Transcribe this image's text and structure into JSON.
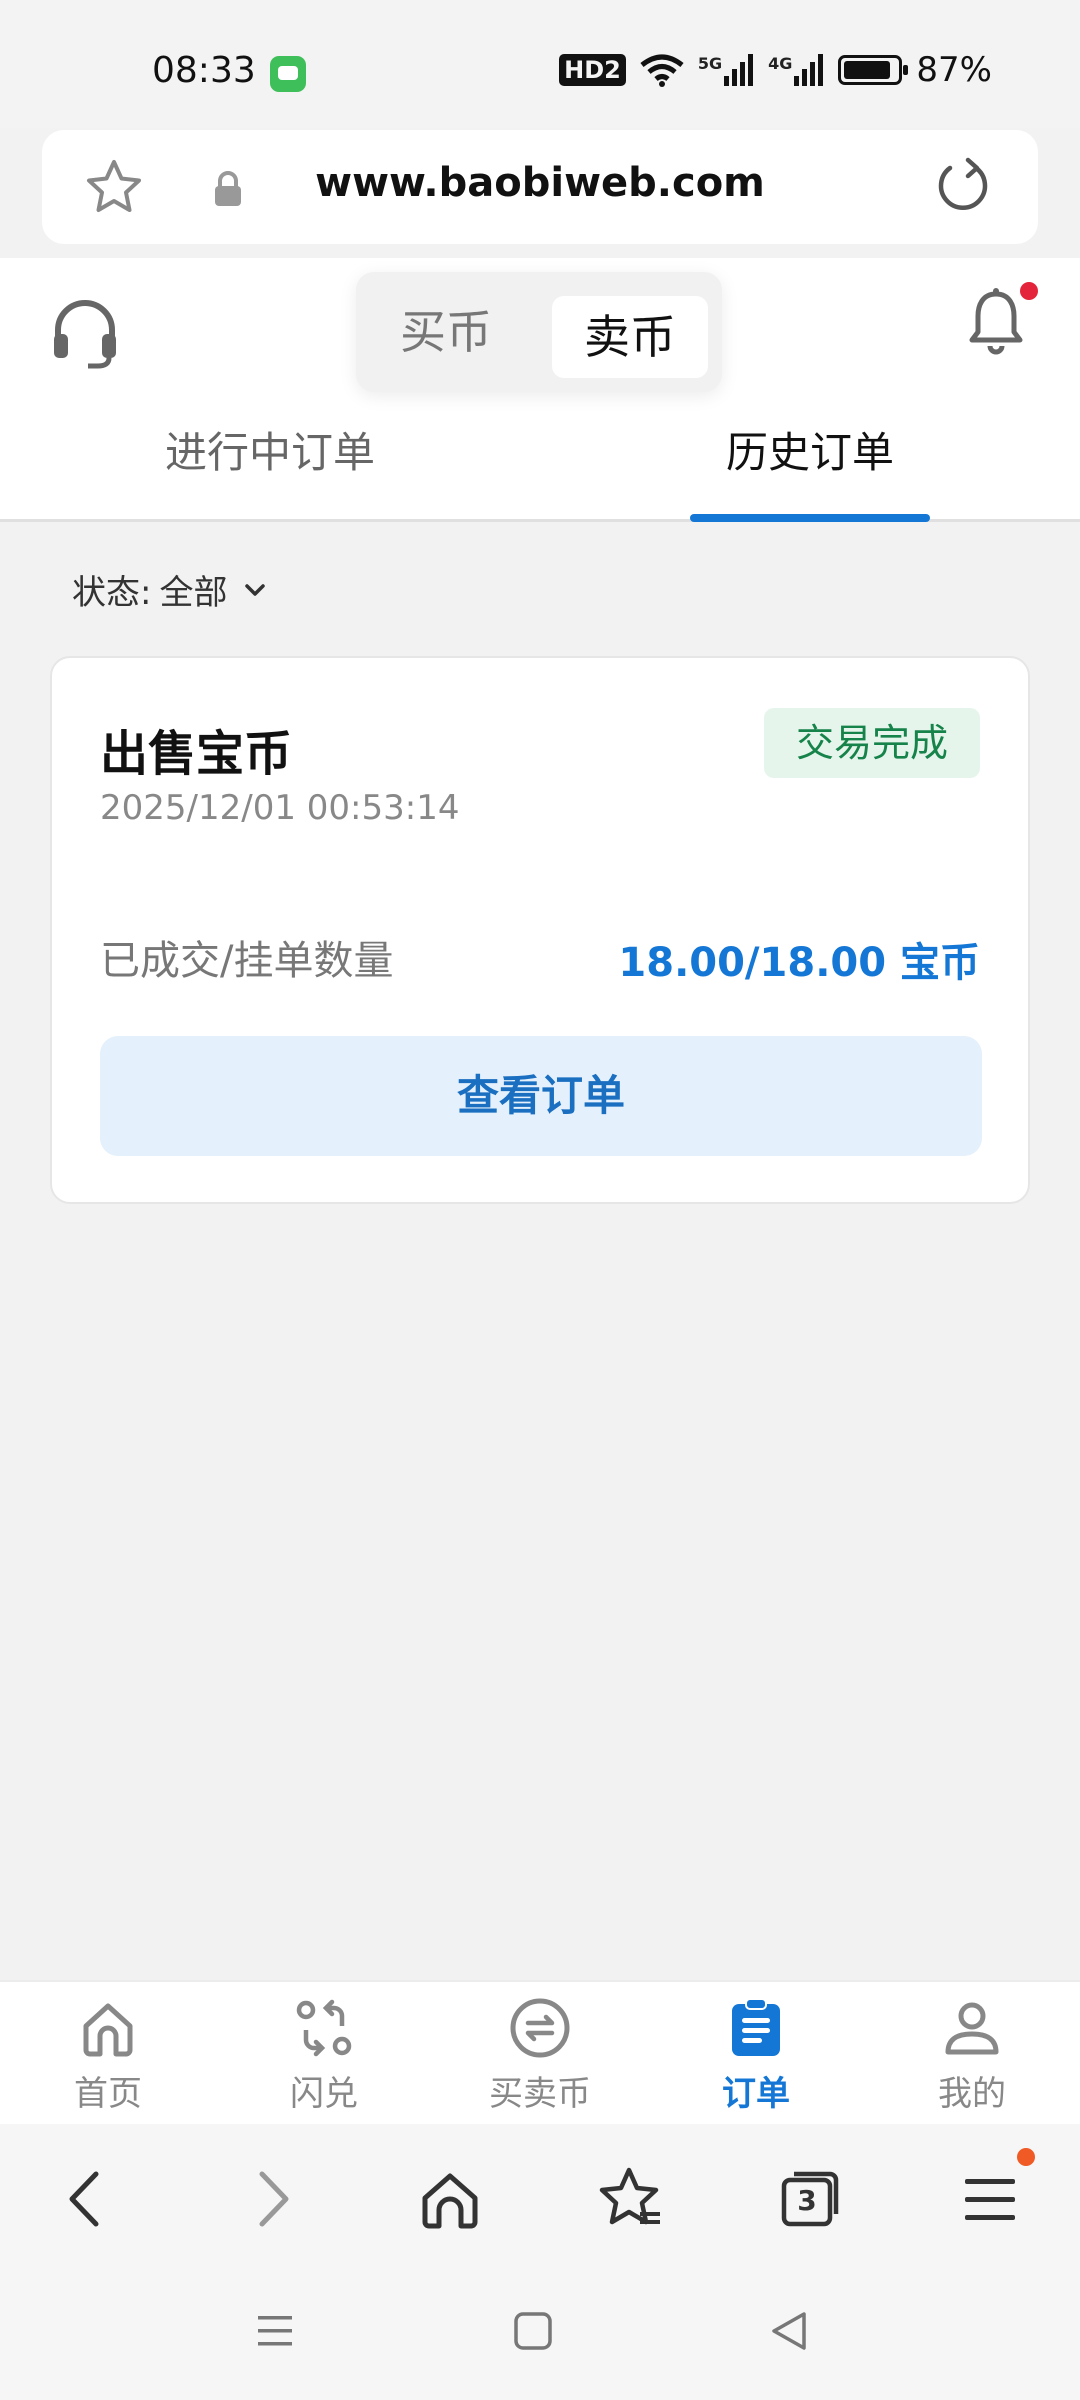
{
  "status_bar": {
    "time": "08:33",
    "hd": "HD2",
    "net1": "5G",
    "net2": "4G",
    "battery": "87%"
  },
  "browser": {
    "url": "www.baobiweb.com"
  },
  "header": {
    "segment": {
      "buy_label": "买币",
      "sell_label": "卖币",
      "selected": "sell_label"
    },
    "tabs": [
      {
        "label": "进行中订单"
      },
      {
        "label": "历史订单"
      }
    ],
    "active_tab": 1
  },
  "filter": {
    "label": "状态:",
    "value": "全部"
  },
  "order": {
    "title": "出售宝币",
    "status": "交易完成",
    "time": "2025/12/01 00:53:14",
    "qty_label": "已成交/挂单数量",
    "qty_value": "18.00/18.00 宝币",
    "button": "查看订单"
  },
  "bottom_nav": {
    "items": [
      {
        "label": "首页",
        "icon": "home-icon"
      },
      {
        "label": "闪兑",
        "icon": "swap-icon"
      },
      {
        "label": "买卖币",
        "icon": "exchange-icon"
      },
      {
        "label": "订单",
        "icon": "order-icon"
      },
      {
        "label": "我的",
        "icon": "user-icon"
      }
    ],
    "active": 3
  },
  "browser_toolbar": {
    "tab_count": "3"
  },
  "colors": {
    "accent": "#1477d6",
    "success": "#16834a",
    "success_bg": "#e6f5ec",
    "notify_dot": "#e4243a"
  }
}
